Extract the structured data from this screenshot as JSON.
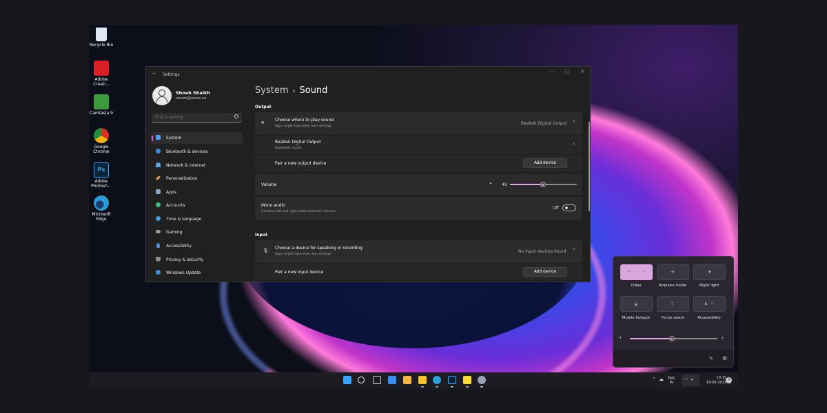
{
  "desktop": {
    "icons": [
      {
        "label": "Recycle Bin",
        "icon": "recycle-bin-icon",
        "color": "#dfe9f5"
      },
      {
        "label": "Adobe Creati...",
        "icon": "adobe-creative-cloud-icon",
        "color": "#da1f26"
      },
      {
        "label": "Camtasia 9",
        "icon": "camtasia-icon",
        "color": "#3b9a3a"
      },
      {
        "label": "Google Chrome",
        "icon": "chrome-icon",
        "color": "#e8b12a"
      },
      {
        "label": "Adobe Photosh...",
        "icon": "photoshop-icon",
        "color": "#0d2438"
      },
      {
        "label": "Microsoft Edge",
        "icon": "edge-icon",
        "color": "#2a9ad8"
      }
    ]
  },
  "window": {
    "title": "Settings",
    "controls": {
      "minimize": "—",
      "maximize": "▢",
      "close": "✕"
    },
    "back": "←"
  },
  "user": {
    "name": "Shoeb Shaikh",
    "email": "shoeb@ozias.co"
  },
  "search": {
    "placeholder": "Find a setting"
  },
  "nav": [
    {
      "label": "System",
      "icon": "system-icon",
      "color": "#4aa3ff",
      "active": true
    },
    {
      "label": "Bluetooth & devices",
      "icon": "bluetooth-icon",
      "color": "#3b8ee8"
    },
    {
      "label": "Network & internet",
      "icon": "network-icon",
      "color": "#59a8e8"
    },
    {
      "label": "Personalization",
      "icon": "personalization-icon",
      "color": "#e8a24a"
    },
    {
      "label": "Apps",
      "icon": "apps-icon",
      "color": "#8aa8c8"
    },
    {
      "label": "Accounts",
      "icon": "accounts-icon",
      "color": "#3fc08a"
    },
    {
      "label": "Time & language",
      "icon": "time-language-icon",
      "color": "#3d9fe0"
    },
    {
      "label": "Gaming",
      "icon": "gaming-icon",
      "color": "#a0a0a0"
    },
    {
      "label": "Accessibility",
      "icon": "accessibility-icon",
      "color": "#4a90e2"
    },
    {
      "label": "Privacy & security",
      "icon": "privacy-icon",
      "color": "#8b8b8b"
    },
    {
      "label": "Windows Update",
      "icon": "windows-update-icon",
      "color": "#3d8fe0"
    }
  ],
  "main": {
    "breadcrumb": {
      "parent": "System",
      "separator": "›",
      "current": "Sound"
    },
    "output": {
      "heading": "Output",
      "choose": {
        "title": "Choose where to play sound",
        "subtitle": "Apps might have their own settings",
        "value": "Realtek Digital Output"
      },
      "device": {
        "title": "Realtek Digital Output",
        "subtitle": "Realtek(R) Audio"
      },
      "pair": {
        "title": "Pair a new output device",
        "button": "Add device"
      },
      "volume": {
        "label": "Volume",
        "value": "49",
        "level": 49
      },
      "mono": {
        "title": "Mono audio",
        "subtitle": "Combine left and right audio channels into one",
        "state": "Off"
      }
    },
    "input": {
      "heading": "Input",
      "choose": {
        "title": "Choose a device for speaking or recording",
        "subtitle": "Apps might have their own settings",
        "value": "No input devices found"
      },
      "pair": {
        "title": "Pair a new input device",
        "button": "Add device"
      }
    }
  },
  "quick": {
    "tiles": [
      {
        "label": "Ozias",
        "icon": "wifi-icon",
        "on": true
      },
      {
        "label": "Airplane mode",
        "icon": "airplane-icon",
        "on": false
      },
      {
        "label": "Night light",
        "icon": "night-light-icon",
        "on": false
      },
      {
        "label": "Mobile hotspot",
        "icon": "hotspot-icon",
        "on": false
      },
      {
        "label": "Focus assist",
        "icon": "focus-assist-icon",
        "on": false
      },
      {
        "label": "Accessibility",
        "icon": "accessibility-icon",
        "on": false
      }
    ],
    "volume_level": 48
  },
  "taskbar": {
    "apps": [
      {
        "icon": "start-icon",
        "color": "#3aa2ff"
      },
      {
        "icon": "search-icon",
        "color": "#ffffff"
      },
      {
        "icon": "task-view-icon",
        "color": "#cfcfcf"
      },
      {
        "icon": "widgets-icon",
        "color": "#3a8df0"
      },
      {
        "icon": "store-icon",
        "color": "#f4b342"
      },
      {
        "icon": "file-explorer-icon",
        "color": "#f2c230"
      },
      {
        "icon": "edge-icon",
        "color": "#2aa3d8"
      },
      {
        "icon": "photoshop-icon",
        "color": "#0d2438"
      },
      {
        "icon": "sticky-notes-icon",
        "color": "#f7dc3b"
      },
      {
        "icon": "settings-icon",
        "color": "#9aa3b5"
      }
    ],
    "language": {
      "line1": "ENG",
      "line2": "IN"
    },
    "clock": {
      "time": "20:15",
      "date": "18-08-2021"
    },
    "notifications": "3"
  }
}
